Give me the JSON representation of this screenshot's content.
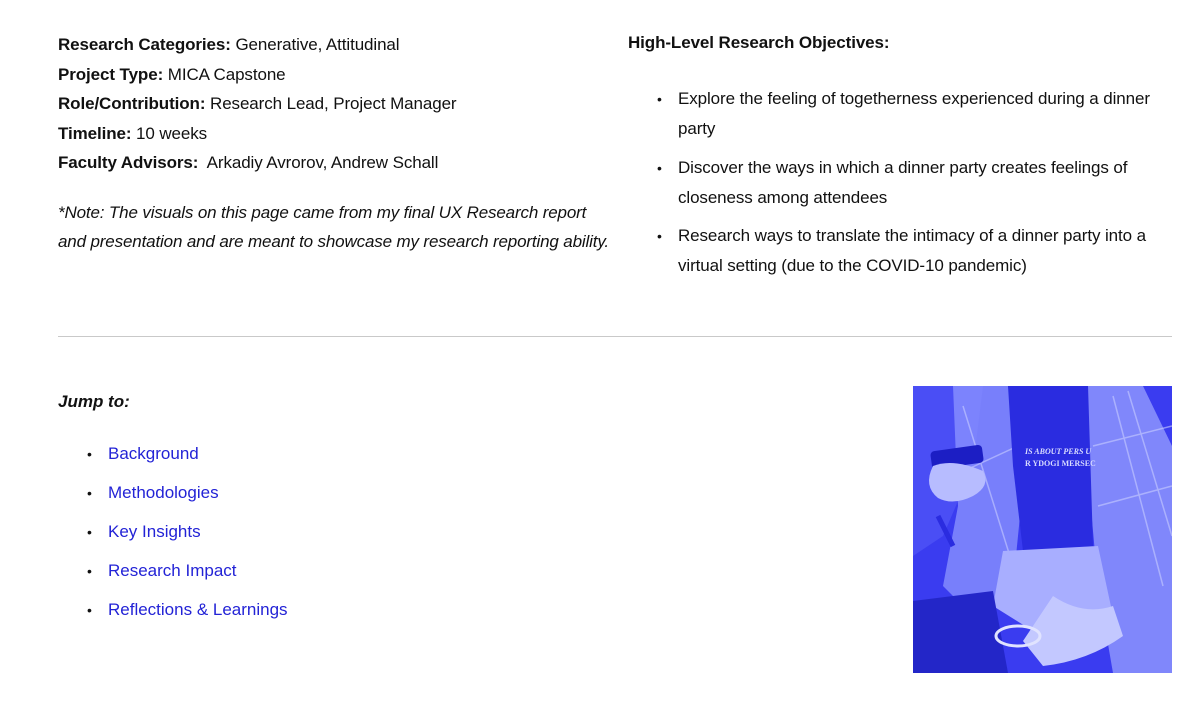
{
  "project_meta": [
    {
      "label": "Research Categories:",
      "value": "Generative, Attitudinal"
    },
    {
      "label": "Project Type:",
      "value": "MICA Capstone"
    },
    {
      "label": "Role/Contribution:",
      "value": "Research Lead, Project Manager"
    },
    {
      "label": "Timeline:",
      "value": "10 weeks"
    },
    {
      "label": "Faculty Advisors:",
      "value": " Arkadiy Avrorov, Andrew Schall"
    }
  ],
  "note": "*Note: The visuals on this page came from my final UX Research report and presentation and are meant to showcase my research reporting ability.",
  "objectives": {
    "heading": "High-Level Research Objectives:",
    "items": [
      "Explore the feeling of togetherness experienced during a dinner party",
      "Discover the ways in which a dinner party creates feelings of closeness among attendees",
      "Research ways to translate the intimacy of a dinner party into a virtual setting (due to the COVID-10 pandemic)"
    ]
  },
  "jump_to": {
    "heading": "Jump to:",
    "links": [
      "Background",
      "Methodologies",
      "Key Insights",
      "Research Impact",
      "Reflections & Learnings"
    ]
  },
  "bullet_glyph": "•",
  "hero_image": {
    "alt": "Blue duotone photo of a person holding a phone, wearing a graphic t-shirt and plaid shirt",
    "shirt_text_line1": "IS ABOUT PERS U",
    "shirt_text_line2": "R YDOGI MERSEC"
  },
  "colors": {
    "link": "#2323d6",
    "text": "#111111",
    "divider": "#c9c9c9",
    "duotone_dark": "#2b2ee8",
    "duotone_light": "#a9b0ff"
  }
}
